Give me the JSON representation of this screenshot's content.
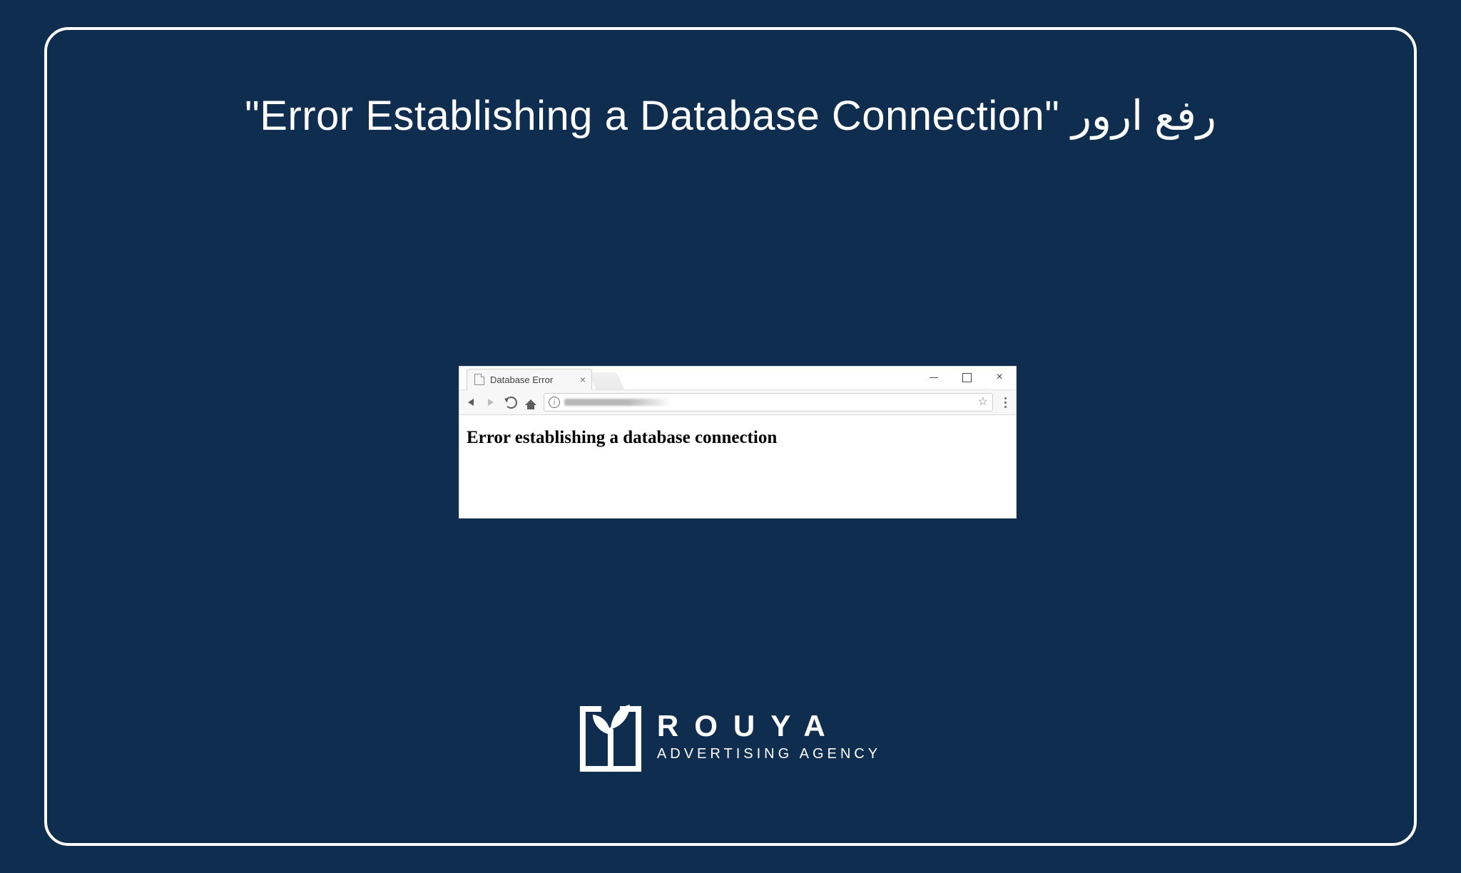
{
  "headline": "\"Error Establishing a Database Connection\" رفع ارور",
  "browser": {
    "tab_title": "Database Error",
    "omnibox_info_glyph": "i",
    "page_error": "Error establishing a database connection"
  },
  "logo": {
    "brand": "ROUYA",
    "tagline": "ADVERTISING AGENCY"
  }
}
